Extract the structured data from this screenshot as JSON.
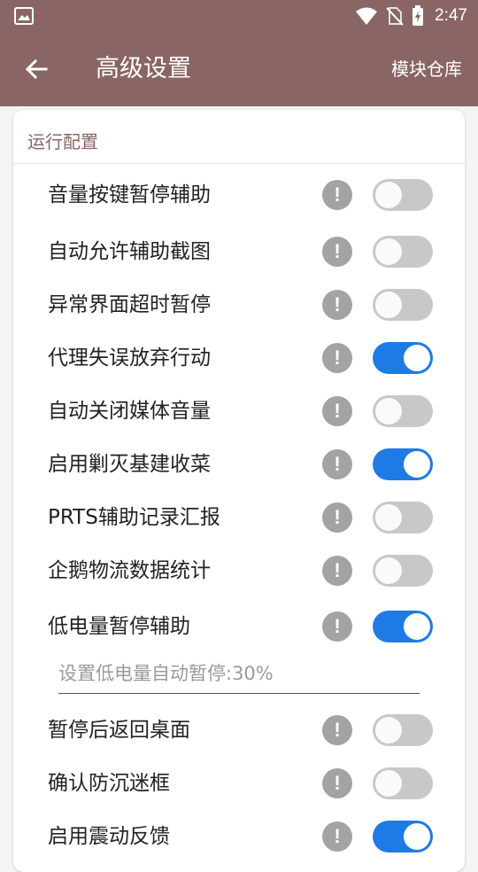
{
  "status_bar": {
    "time": "2:47",
    "icons": [
      "image-notification-icon",
      "wifi-icon",
      "no-sim-icon",
      "battery-charging-icon"
    ]
  },
  "toolbar": {
    "back_icon": "arrow-left-icon",
    "title": "高级设置",
    "action": "模块仓库"
  },
  "section": {
    "title": "运行配置",
    "settings": [
      {
        "label": "音量按键暂停辅助",
        "enabled": false
      },
      {
        "label": "自动允许辅助截图",
        "enabled": false
      },
      {
        "label": "异常界面超时暂停",
        "enabled": false
      },
      {
        "label": "代理失误放弃行动",
        "enabled": true
      },
      {
        "label": "自动关闭媒体音量",
        "enabled": false
      },
      {
        "label": "启用剿灭基建收菜",
        "enabled": true
      },
      {
        "label": "PRTS辅助记录汇报",
        "enabled": false
      },
      {
        "label": "企鹅物流数据统计",
        "enabled": false
      },
      {
        "label": "低电量暂停辅助",
        "enabled": true
      },
      {
        "label": "暂停后返回桌面",
        "enabled": false
      },
      {
        "label": "确认防沉迷框",
        "enabled": false
      },
      {
        "label": "启用震动反馈",
        "enabled": true
      }
    ],
    "help_glyph": "!",
    "low_battery_input": {
      "placeholder": "设置低电量自动暂停:30%",
      "value": ""
    }
  },
  "colors": {
    "primary": "#8a6565",
    "toggle_on": "#1e7be6",
    "toggle_off": "#c8c8c8",
    "help_icon": "#a3a3a3"
  }
}
